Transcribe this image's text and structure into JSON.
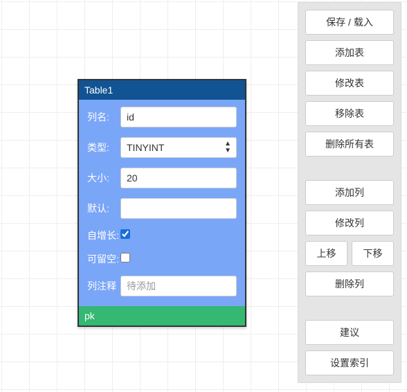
{
  "table": {
    "title": "Table1",
    "footer": "pk",
    "fields": {
      "col_name_label": "列名:",
      "col_name_value": "id",
      "type_label": "类型:",
      "type_value": "TINYINT",
      "size_label": "大小:",
      "size_value": "20",
      "default_label": "默认:",
      "default_value": "",
      "autoinc_label": "自增长:",
      "autoinc_checked": true,
      "nullable_label": "可留空:",
      "nullable_checked": false,
      "comment_label": "列注释",
      "comment_placeholder": "待添加",
      "comment_value": ""
    }
  },
  "sidebar": {
    "save_load": "保存 / 载入",
    "add_table": "添加表",
    "edit_table": "修改表",
    "remove_table": "移除表",
    "delete_all_tables": "删除所有表",
    "add_column": "添加列",
    "edit_column": "修改列",
    "move_up": "上移",
    "move_down": "下移",
    "delete_column": "删除列",
    "suggest": "建议",
    "set_index": "设置索引"
  }
}
